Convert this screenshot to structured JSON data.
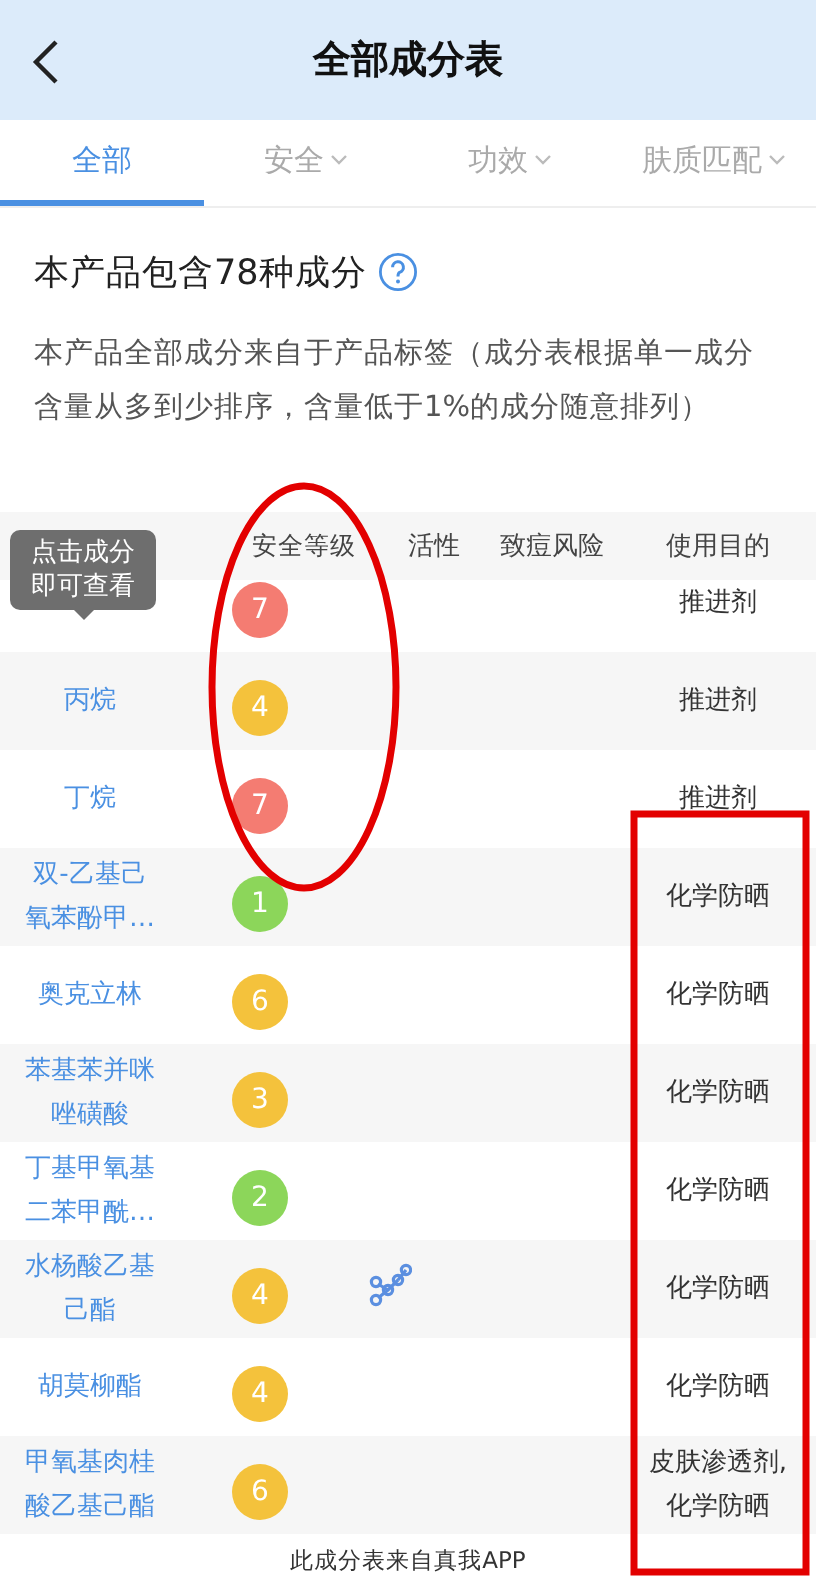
{
  "header": {
    "title": "全部成分表"
  },
  "tabs": [
    {
      "label": "全部",
      "selected": true,
      "dropdown": false
    },
    {
      "label": "安全",
      "selected": false,
      "dropdown": true
    },
    {
      "label": "功效",
      "selected": false,
      "dropdown": true
    },
    {
      "label": "肤质匹配",
      "selected": false,
      "dropdown": true
    }
  ],
  "summary": {
    "title": "本产品包含78种成分",
    "description": "本产品全部成分来自于产品标签（成分表根据单一成分含量从多到少排序，含量低于1%的成分随意排列）"
  },
  "table": {
    "columns": [
      "安全等级",
      "活性",
      "致痘风险",
      "使用目的"
    ],
    "tooltip": "点击成分即可查看",
    "rows": [
      {
        "safety": "7",
        "color": "#f47c72",
        "active": false,
        "purpose": "推进剂"
      },
      {
        "name": "丙烷",
        "safety": "4",
        "color": "#f4c23c",
        "active": false,
        "purpose": "推进剂"
      },
      {
        "name": "丁烷",
        "safety": "7",
        "color": "#f47c72",
        "active": false,
        "purpose": "推进剂"
      },
      {
        "name": "双-乙基己氧苯酚甲…",
        "safety": "1",
        "color": "#8cd65a",
        "active": false,
        "purpose": "化学防晒"
      },
      {
        "name": "奥克立林",
        "safety": "6",
        "color": "#f4c23c",
        "active": false,
        "purpose": "化学防晒"
      },
      {
        "name": "苯基苯并咪唑磺酸",
        "safety": "3",
        "color": "#f4c23c",
        "active": false,
        "purpose": "化学防晒"
      },
      {
        "name": "丁基甲氧基二苯甲酰…",
        "safety": "2",
        "color": "#8cd65a",
        "active": false,
        "purpose": "化学防晒"
      },
      {
        "name": "水杨酸乙基己酯",
        "safety": "4",
        "color": "#f4c23c",
        "active": true,
        "purpose": "化学防晒"
      },
      {
        "name": "胡莫柳酯",
        "safety": "4",
        "color": "#f4c23c",
        "active": false,
        "purpose": "化学防晒"
      },
      {
        "name": "甲氧基肉桂酸乙基己酯",
        "safety": "6",
        "color": "#f4c23c",
        "active": false,
        "purpose": "皮肤渗透剂,化学防晒"
      }
    ]
  },
  "footer": "此成分表来自真我APP",
  "annotations": [
    {
      "kind": "ellipse"
    },
    {
      "kind": "rectangle"
    }
  ]
}
